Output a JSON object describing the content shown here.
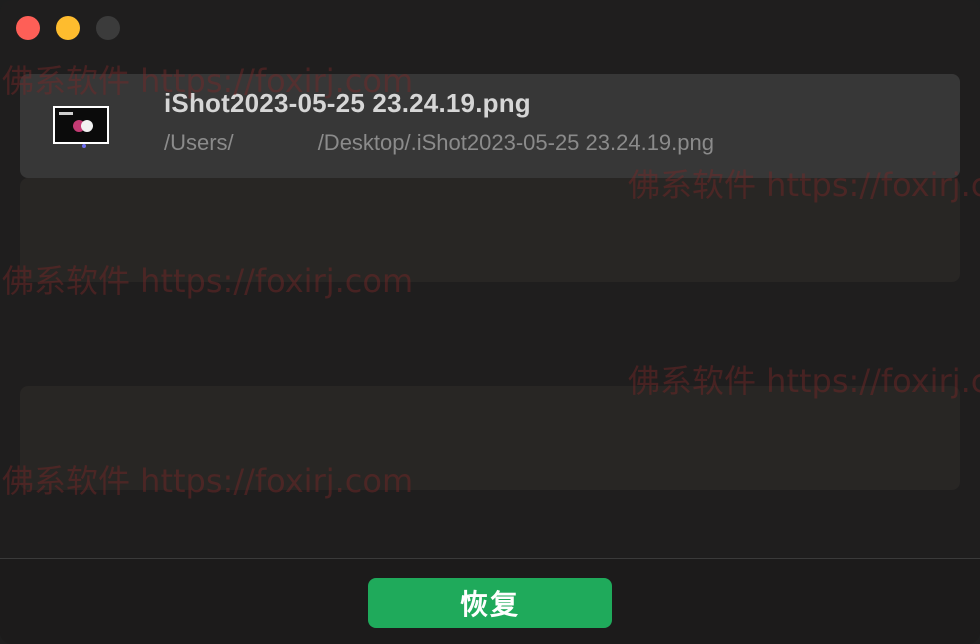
{
  "window": {
    "controls": {
      "close": "close-dot",
      "minimize": "minimize-dot",
      "zoom": "zoom-dot"
    }
  },
  "files": [
    {
      "name": "iShot2023-05-25 23.24.19.png",
      "path_prefix": "/Users/",
      "path_suffix": "/Desktop/.iShot2023-05-25 23.24.19.png",
      "selected": true
    }
  ],
  "footer": {
    "restore_label": "恢复"
  },
  "watermark": {
    "text": "佛系软件 https://foxirj.com"
  },
  "colors": {
    "accent": "#1faa5b",
    "close": "#fe5f57",
    "minimize": "#febc2e"
  }
}
